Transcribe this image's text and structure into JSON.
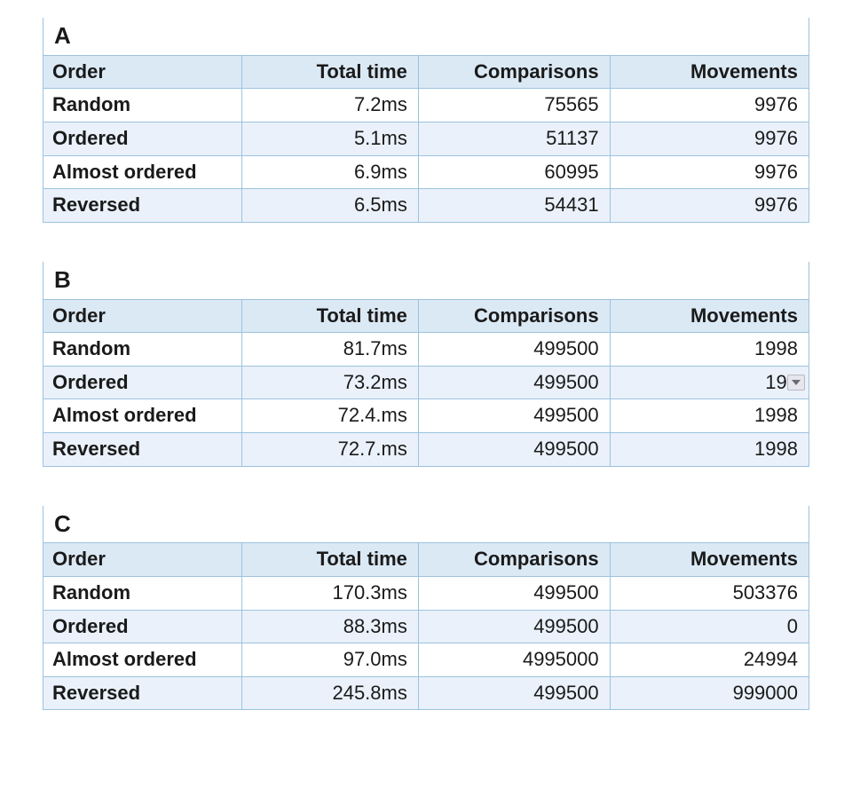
{
  "columns": {
    "order": "Order",
    "total_time": "Total time",
    "comparisons": "Comparisons",
    "movements": "Movements"
  },
  "tables": [
    {
      "title": "A",
      "rows": [
        {
          "order": "Random",
          "total_time": "7.2ms",
          "comparisons": "75565",
          "movements": "9976"
        },
        {
          "order": "Ordered",
          "total_time": "5.1ms",
          "comparisons": "51137",
          "movements": "9976"
        },
        {
          "order": "Almost ordered",
          "total_time": "6.9ms",
          "comparisons": "60995",
          "movements": "9976"
        },
        {
          "order": "Reversed",
          "total_time": "6.5ms",
          "comparisons": "54431",
          "movements": "9976"
        }
      ]
    },
    {
      "title": "B",
      "rows": [
        {
          "order": "Random",
          "total_time": "81.7ms",
          "comparisons": "499500",
          "movements": "1998"
        },
        {
          "order": "Ordered",
          "total_time": "73.2ms",
          "comparisons": "499500",
          "movements": "199",
          "has_dropdown": true
        },
        {
          "order": "Almost ordered",
          "total_time": "72.4.ms",
          "comparisons": "499500",
          "movements": "1998"
        },
        {
          "order": "Reversed",
          "total_time": "72.7.ms",
          "comparisons": "499500",
          "movements": "1998"
        }
      ]
    },
    {
      "title": "C",
      "rows": [
        {
          "order": "Random",
          "total_time": "170.3ms",
          "comparisons": "499500",
          "movements": "503376"
        },
        {
          "order": "Ordered",
          "total_time": "88.3ms",
          "comparisons": "499500",
          "movements": "0"
        },
        {
          "order": "Almost ordered",
          "total_time": "97.0ms",
          "comparisons": "4995000",
          "movements": "24994"
        },
        {
          "order": "Reversed",
          "total_time": "245.8ms",
          "comparisons": "499500",
          "movements": "999000"
        }
      ]
    }
  ],
  "chart_data": [
    {
      "type": "table",
      "title": "A",
      "columns": [
        "Order",
        "Total time",
        "Comparisons",
        "Movements"
      ],
      "rows": [
        [
          "Random",
          "7.2ms",
          75565,
          9976
        ],
        [
          "Ordered",
          "5.1ms",
          51137,
          9976
        ],
        [
          "Almost ordered",
          "6.9ms",
          60995,
          9976
        ],
        [
          "Reversed",
          "6.5ms",
          54431,
          9976
        ]
      ]
    },
    {
      "type": "table",
      "title": "B",
      "columns": [
        "Order",
        "Total time",
        "Comparisons",
        "Movements"
      ],
      "rows": [
        [
          "Random",
          "81.7ms",
          499500,
          1998
        ],
        [
          "Ordered",
          "73.2ms",
          499500,
          199
        ],
        [
          "Almost ordered",
          "72.4.ms",
          499500,
          1998
        ],
        [
          "Reversed",
          "72.7.ms",
          499500,
          1998
        ]
      ]
    },
    {
      "type": "table",
      "title": "C",
      "columns": [
        "Order",
        "Total time",
        "Comparisons",
        "Movements"
      ],
      "rows": [
        [
          "Random",
          "170.3ms",
          499500,
          503376
        ],
        [
          "Ordered",
          "88.3ms",
          499500,
          0
        ],
        [
          "Almost ordered",
          "97.0ms",
          4995000,
          24994
        ],
        [
          "Reversed",
          "245.8ms",
          499500,
          999000
        ]
      ]
    }
  ]
}
